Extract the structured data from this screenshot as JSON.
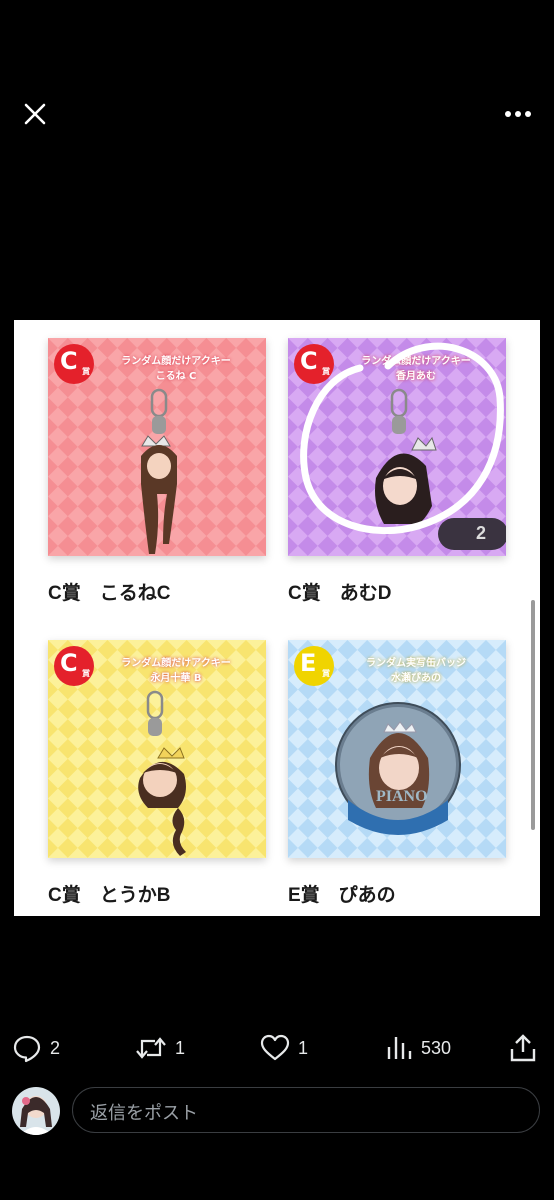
{
  "viewer": {
    "close_icon": "close-icon",
    "more_icon": "more-horizontal-icon"
  },
  "cards": [
    {
      "badge_letter": "C",
      "badge_suffix": "賞",
      "title_line1": "ランダム顔だけアクキー",
      "title_line2": "こるね C",
      "caption": "C賞　こるねC",
      "bg_light": "#f9a5a8",
      "bg_dark": "#f58e93",
      "badge_color": "#e4212b"
    },
    {
      "badge_letter": "C",
      "badge_suffix": "賞",
      "title_line1": "ランダム顔だけアクキー",
      "title_line2": "香月あむ",
      "caption": "C賞　あむD",
      "bg_light": "#d8a9f3",
      "bg_dark": "#c48be9",
      "badge_color": "#e4212b",
      "overlay_badge": "2"
    },
    {
      "badge_letter": "C",
      "badge_suffix": "賞",
      "title_line1": "ランダム顔だけアクキー",
      "title_line2": "永月十華 B",
      "caption": "C賞　とうかB",
      "bg_light": "#fcf19a",
      "bg_dark": "#f8e46f",
      "badge_color": "#e4212b"
    },
    {
      "badge_letter": "E",
      "badge_suffix": "賞",
      "title_line1": "ランダム実写缶バッジ",
      "title_line2": "水瀬ぴあの",
      "caption": "E賞　ぴあの",
      "bg_light": "#d6ecfc",
      "bg_dark": "#b5daf6",
      "badge_color": "#f0d400",
      "badge_text_note": "PIANO"
    }
  ],
  "actions": {
    "replies": {
      "icon": "reply-icon",
      "count": "2"
    },
    "reposts": {
      "icon": "repost-icon",
      "count": "1"
    },
    "likes": {
      "icon": "heart-icon",
      "count": "1"
    },
    "views": {
      "icon": "views-icon",
      "count": "530"
    },
    "share": {
      "icon": "share-icon"
    }
  },
  "reply": {
    "placeholder": "返信をポスト"
  }
}
